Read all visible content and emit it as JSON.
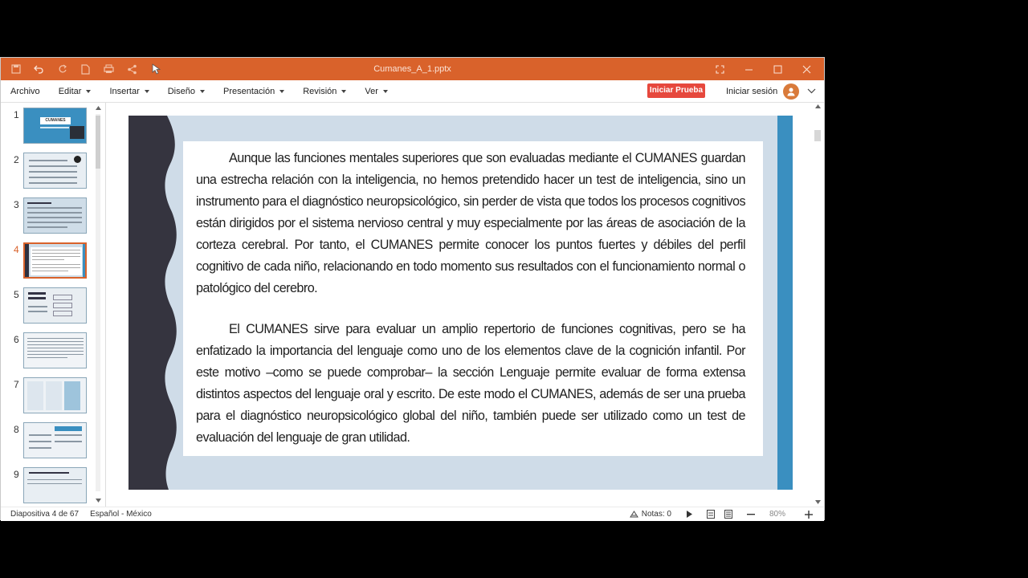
{
  "window": {
    "title": "Cumanes_A_1.pptx",
    "accent_color": "#d9622b",
    "quick_icons": [
      "save-icon",
      "undo-icon",
      "redo-icon",
      "new-file-icon",
      "print-icon",
      "share-icon",
      "cursor-icon"
    ],
    "controls": [
      "fullscreen-icon",
      "minimize-icon",
      "maximize-icon",
      "close-icon"
    ]
  },
  "menu": {
    "file": "Archivo",
    "items": [
      {
        "label": "Editar"
      },
      {
        "label": "Insertar"
      },
      {
        "label": "Diseño"
      },
      {
        "label": "Presentación"
      },
      {
        "label": "Revisión"
      },
      {
        "label": "Ver"
      }
    ],
    "try_button": "Iniciar Prueba",
    "login": "Iniciar sesión"
  },
  "thumbnails": {
    "items": [
      {
        "num": "1",
        "title": "CUMANES"
      },
      {
        "num": "2"
      },
      {
        "num": "3"
      },
      {
        "num": "4",
        "active": true
      },
      {
        "num": "5"
      },
      {
        "num": "6"
      },
      {
        "num": "7"
      },
      {
        "num": "8"
      },
      {
        "num": "9"
      }
    ]
  },
  "slide": {
    "paragraphs": [
      "Aunque las funciones mentales superiores que son evaluadas mediante el CUMANES guardan una estrecha relación con la inteligencia, no hemos pretendido hacer un test de inteligencia, sino un instrumento para el diagnóstico neuropsicológico, sin perder de vista que todos los procesos cognitivos están dirigidos por el sistema nervioso central y muy especialmente por las áreas de asociación de la corteza cerebral. Por tanto, el CUMANES permite conocer los puntos fuertes y débiles del perfil cognitivo de cada niño, relacionando en todo momento sus resultados con el funcionamiento normal o patológico del cerebro.",
      "El CUMANES sirve para evaluar un amplio repertorio de funciones cognitivas, pero se ha enfatizado la importancia del lenguaje como uno de los elementos clave de la cognición infantil. Por este motivo –como se puede comprobar– la sección Lenguaje permite evaluar de forma extensa distintos aspectos del lenguaje oral y escrito. De este modo el CUMANES, además de ser una prueba para el diagnóstico neuropsicológico global del niño, también puede ser utilizado como un test de evaluación del lenguaje de gran utilidad."
    ]
  },
  "status": {
    "slide_info": "Diapositiva 4 de 67",
    "language": "Español - México",
    "notes": "Notas: 0",
    "zoom": "80%"
  }
}
